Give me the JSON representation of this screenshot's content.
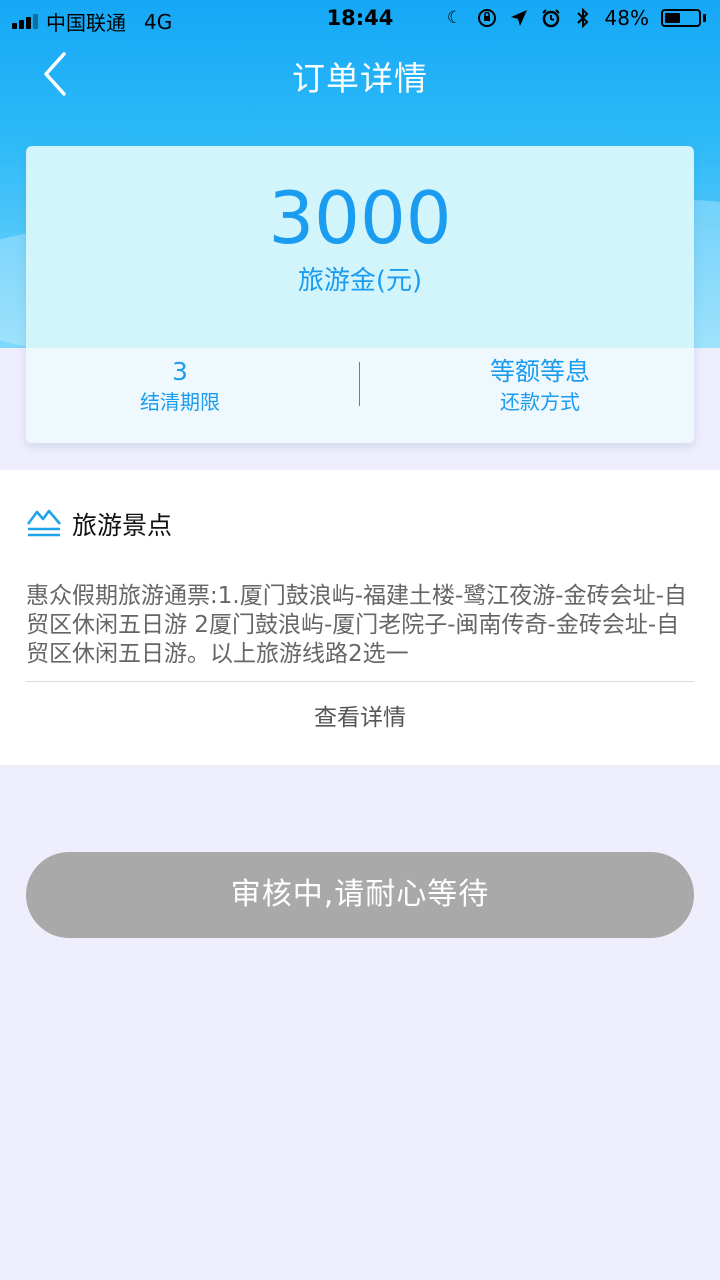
{
  "status_bar": {
    "carrier": "中国联通",
    "network": "4G",
    "time": "18:44",
    "battery": "48%",
    "battery_level": 0.48
  },
  "nav": {
    "title": "订单详情"
  },
  "summary": {
    "amount": "3000",
    "amount_label": "旅游金(元)",
    "term_value": "3",
    "term_label": "结清期限",
    "repay_value": "等额等息",
    "repay_label": "还款方式"
  },
  "attractions": {
    "heading": "旅游景点",
    "description": "惠众假期旅游通票:1.厦门鼓浪屿-福建土楼-鹭江夜游-金砖会址-自贸区休闲五日游 2厦门鼓浪屿-厦门老院子-闽南传奇-金砖会址-自贸区休闲五日游。以上旅游线路2选一",
    "view_details": "查看详情"
  },
  "status_button": {
    "label": "审核中,请耐心等待"
  },
  "colors": {
    "accent": "#1a9cf0",
    "header_top": "#16a8f6",
    "card_bg": "#d2f5fc",
    "page_bg": "#efeefd",
    "button_disabled": "#a9a9a9"
  },
  "icons": [
    "signal-icon",
    "moon-icon",
    "orientation-lock-icon",
    "location-icon",
    "alarm-icon",
    "bluetooth-icon",
    "battery-icon",
    "back-chevron-icon",
    "mountain-landscape-icon"
  ]
}
